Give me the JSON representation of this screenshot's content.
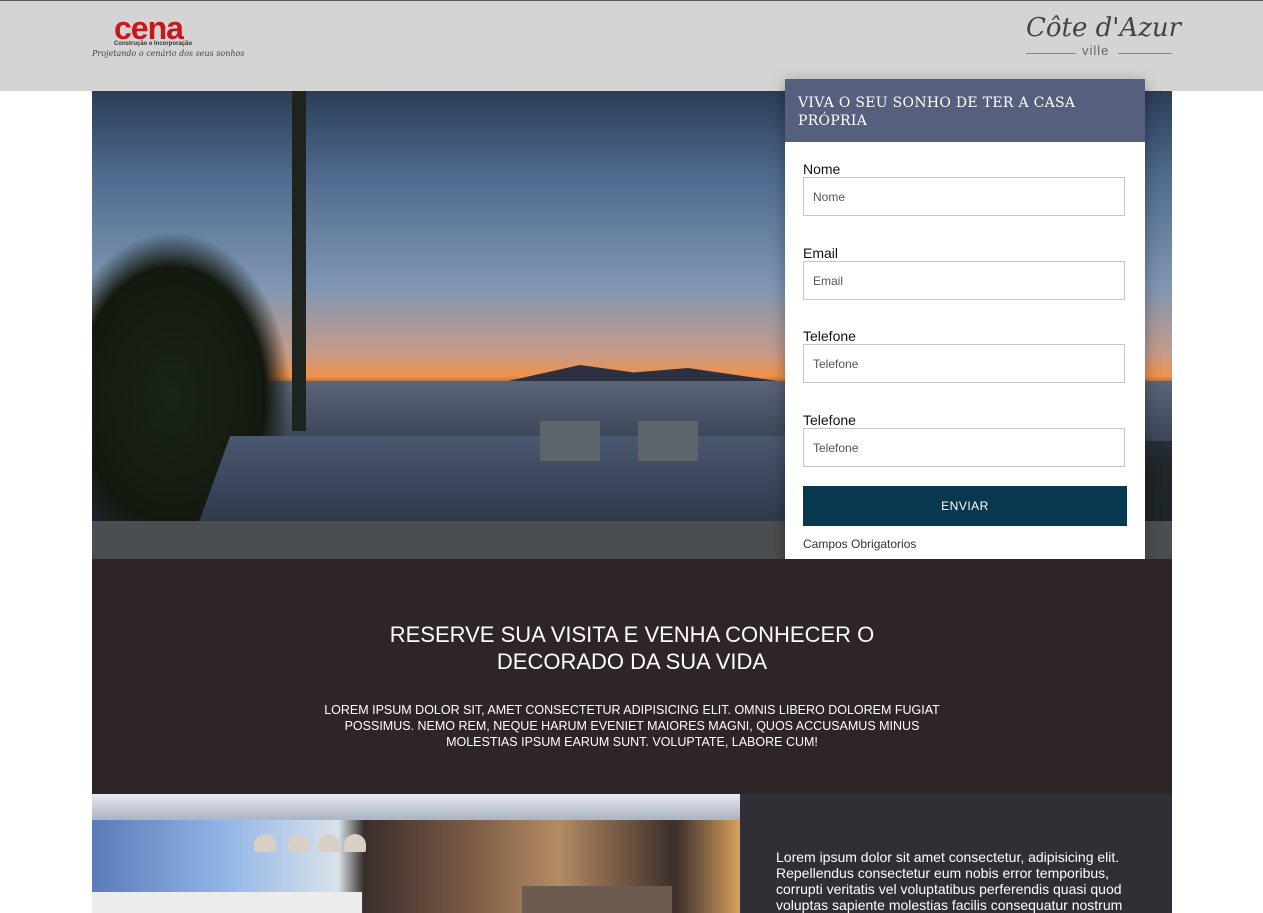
{
  "header": {
    "left_logo": {
      "name": "cena",
      "subtitle": "Construção e Incorporação",
      "tagline": "Projetando o cenário dos seus sonhos"
    },
    "right_logo": {
      "name": "Côte d'Azur",
      "subtitle": "ville"
    }
  },
  "form": {
    "title": "VIVA O SEU SONHO DE TER A CASA PRÓPRIA",
    "fields": [
      {
        "label": "Nome",
        "placeholder": "Nome"
      },
      {
        "label": "Email",
        "placeholder": "Email"
      },
      {
        "label": "Telefone",
        "placeholder": "Telefone"
      },
      {
        "label": "Telefone",
        "placeholder": "Telefone"
      }
    ],
    "submit_label": "ENVIAR",
    "required_note": "Campos Obrigatorios"
  },
  "promo": {
    "title": "RESERVE SUA VISITA E VENHA CONHECER O DECORADO DA SUA VIDA",
    "text": "LOREM IPSUM DOLOR SIT, AMET CONSECTETUR ADIPISICING ELIT. OMNIS LIBERO DOLOREM FUGIAT POSSIMUS. NEMO REM, NEQUE HARUM EVENIET MAIORES MAGNI, QUOS ACCUSAMUS MINUS MOLESTIAS IPSUM EARUM SUNT. VOLUPTATE, LABORE CUM!"
  },
  "bottom": {
    "text": "Lorem ipsum dolor sit amet consectetur, adipisicing elit. Repellendus consectetur eum nobis error temporibus, corrupti veritatis vel voluptatibus perferendis quasi quod voluptas sapiente molestias facilis consequatur nostrum"
  },
  "colors": {
    "header_bg": "#d4d4d4",
    "form_header": "#565f7e",
    "submit_button": "#06384f",
    "promo_bg": "#2f2428",
    "bottom_text_bg": "#2f2f35",
    "brand_red": "#c8161d"
  }
}
